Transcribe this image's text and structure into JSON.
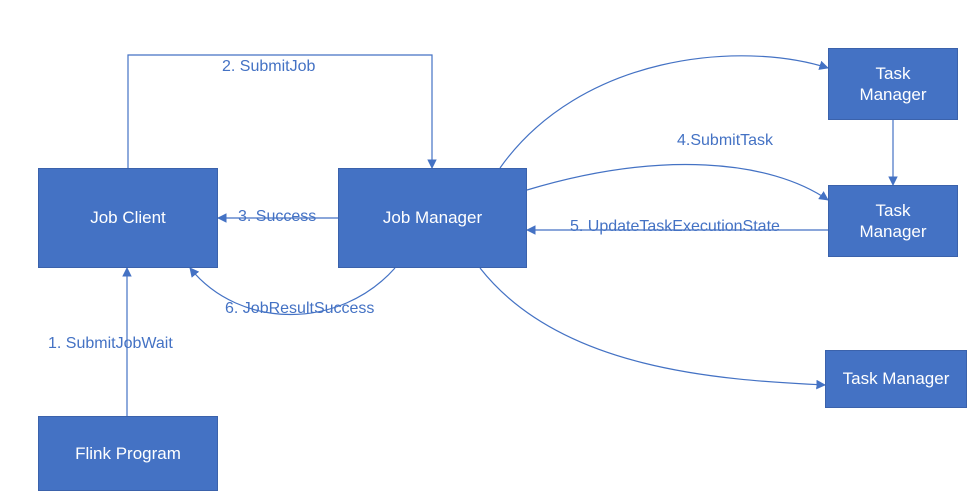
{
  "colors": {
    "box_fill": "#4472c4",
    "text_on_box": "#ffffff",
    "label": "#4472c4",
    "stroke": "#4472c4"
  },
  "nodes": {
    "job_client": {
      "label": "Job Client"
    },
    "job_manager": {
      "label": "Job Manager"
    },
    "flink_program": {
      "label": "Flink Program"
    },
    "tm_top": {
      "label": "Task\nManager"
    },
    "tm_mid": {
      "label": "Task\nManager"
    },
    "tm_bot": {
      "label": "Task Manager"
    }
  },
  "edges": {
    "e1": {
      "label": "1. SubmitJobWait"
    },
    "e2": {
      "label": "2. SubmitJob"
    },
    "e3": {
      "label": "3. Success"
    },
    "e4": {
      "label": "4.SubmitTask"
    },
    "e5": {
      "label": "5. UpdateTaskExecutionState"
    },
    "e6": {
      "label": "6. JobResultSuccess"
    }
  }
}
